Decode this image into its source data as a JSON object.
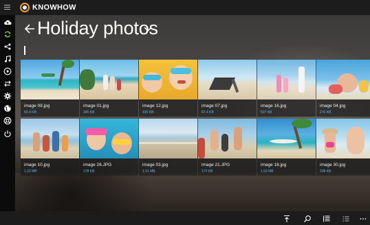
{
  "app": {
    "brand": "KNOWHOW",
    "accent_color": "#f3a21b",
    "size_color": "#5fb8e6"
  },
  "sidebar": {
    "items": [
      {
        "icon": "cloud-icon"
      },
      {
        "icon": "sync-icon",
        "active": true
      },
      {
        "icon": "share-icon"
      },
      {
        "icon": "music-icon"
      },
      {
        "icon": "play-icon"
      },
      {
        "icon": "transfer-icon"
      },
      {
        "icon": "gear-icon"
      },
      {
        "icon": "globe-icon"
      },
      {
        "icon": "support-icon"
      },
      {
        "icon": "power-icon"
      }
    ]
  },
  "header": {
    "title": "Holiday photos",
    "back_icon": "back-arrow-icon",
    "dropdown_icon": "chevron-down-icon"
  },
  "photos": [
    {
      "name": "image 09.jpg",
      "size": "83.4 KB"
    },
    {
      "name": "image 01.jpg",
      "size": "345 KB"
    },
    {
      "name": "image 12.jpg",
      "size": "435 KB"
    },
    {
      "name": "image 07.jpg",
      "size": "87.4 KB"
    },
    {
      "name": "image 16.jpg",
      "size": "507 KB"
    },
    {
      "name": "image 04.jpg",
      "size": "276 KB"
    },
    {
      "name": "image 10.jpg",
      "size": "1.22 MB"
    },
    {
      "name": "image 26.JPG",
      "size": "178 KB"
    },
    {
      "name": "image 03.jpg",
      "size": "1.51 MB"
    },
    {
      "name": "image 21.JPG",
      "size": "173 KB"
    },
    {
      "name": "image 18.jpg",
      "size": "1.59 MB"
    },
    {
      "name": "image 30.jpg",
      "size": "208 KB"
    }
  ],
  "bottom_bar": {
    "items": [
      {
        "icon": "upload-icon"
      },
      {
        "icon": "search-icon"
      },
      {
        "icon": "details-view-icon"
      },
      {
        "icon": "list-view-icon"
      },
      {
        "icon": "more-icon"
      }
    ]
  }
}
